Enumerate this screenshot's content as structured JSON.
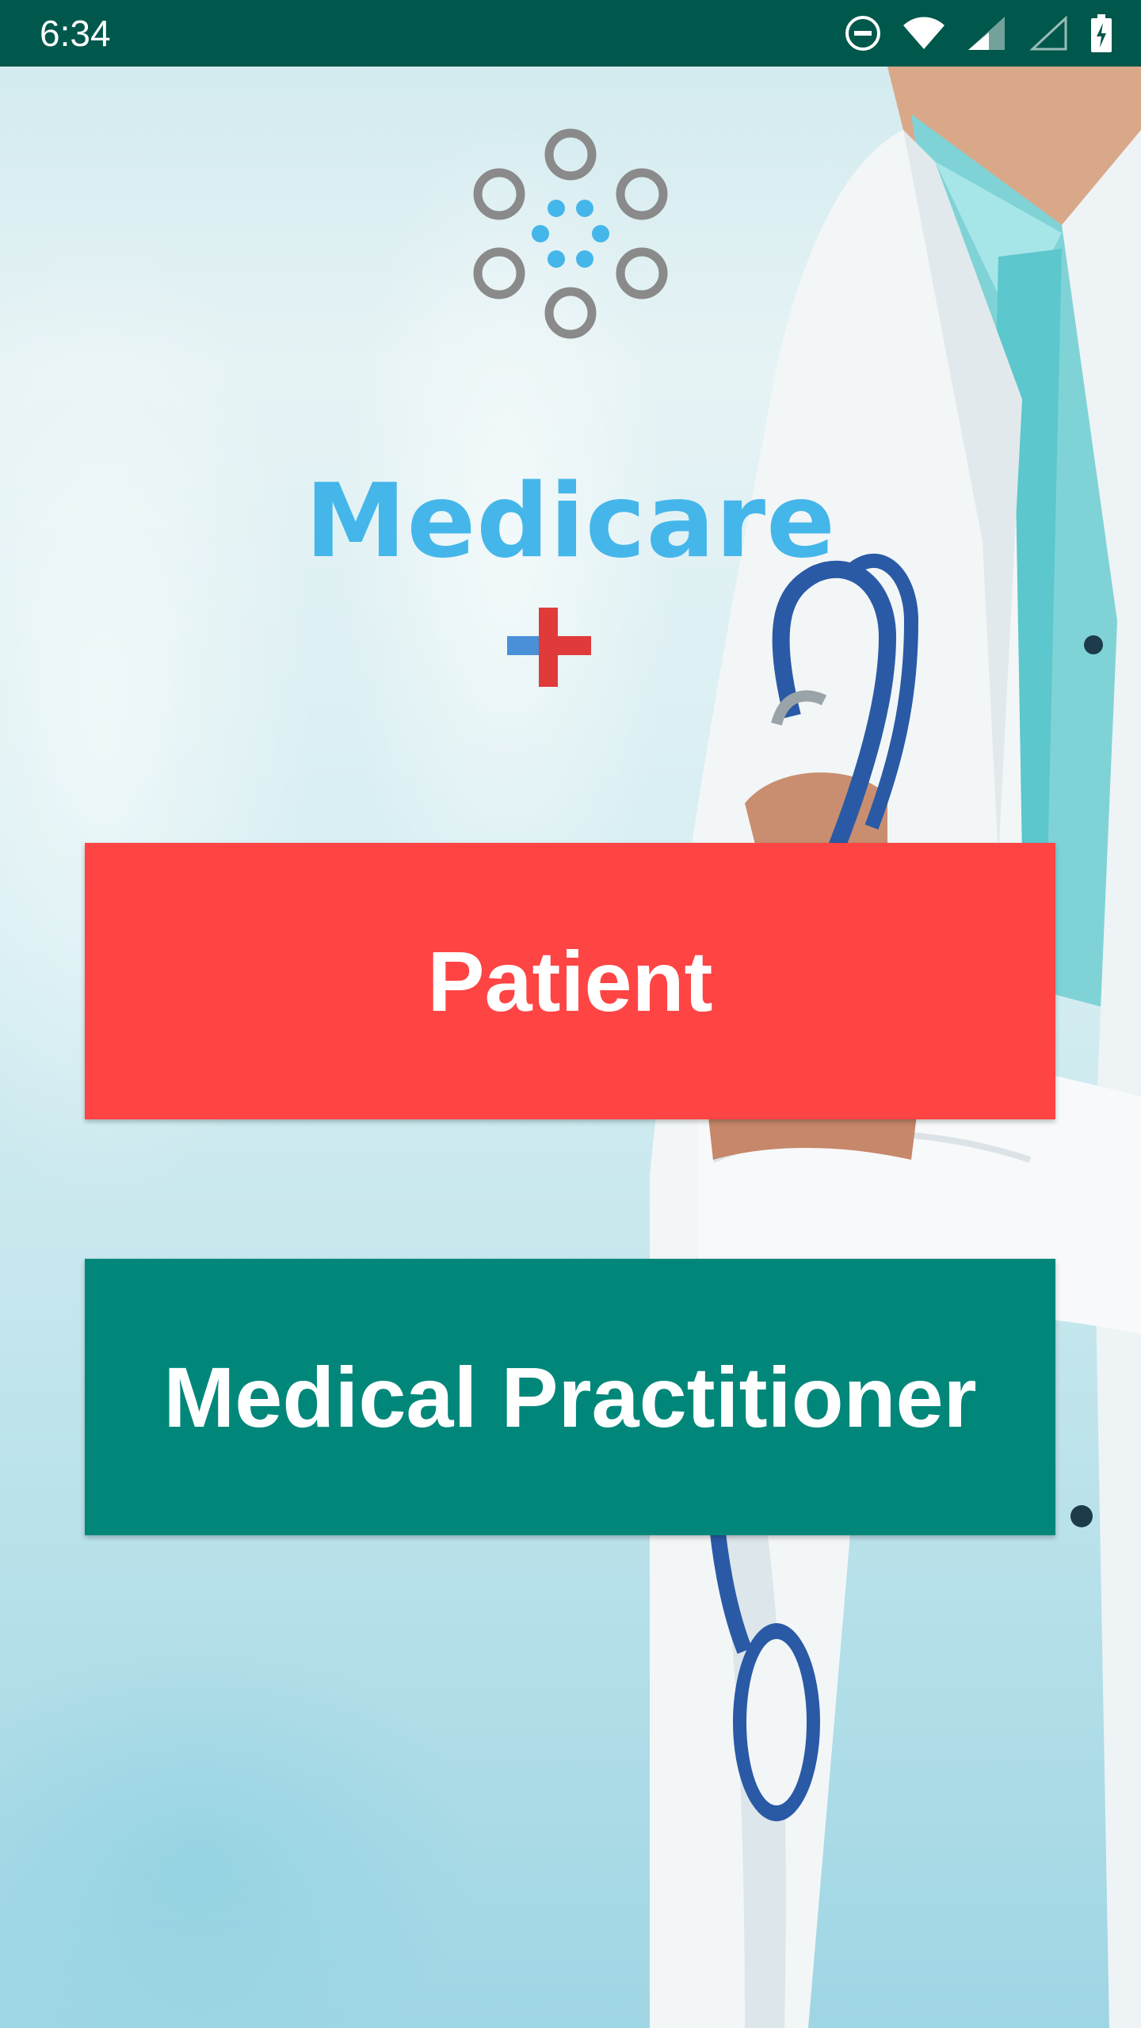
{
  "status_bar": {
    "time": "6:34",
    "icons": [
      "do-not-disturb-icon",
      "wifi-icon",
      "cell-signal-icon",
      "cell-signal-empty-icon",
      "battery-charging-icon"
    ],
    "background_color": "#00574b"
  },
  "logo": {
    "brand_name": "Medicare",
    "brand_color": "#45b6ea",
    "cross_colors": [
      "#4a90d9",
      "#e03a3a"
    ]
  },
  "buttons": {
    "patient_label": "Patient",
    "patient_color": "#ff4444",
    "practitioner_label": "Medical Practitioner",
    "practitioner_color": "#00877a"
  },
  "background": {
    "image": "doctor-with-stethoscope"
  }
}
